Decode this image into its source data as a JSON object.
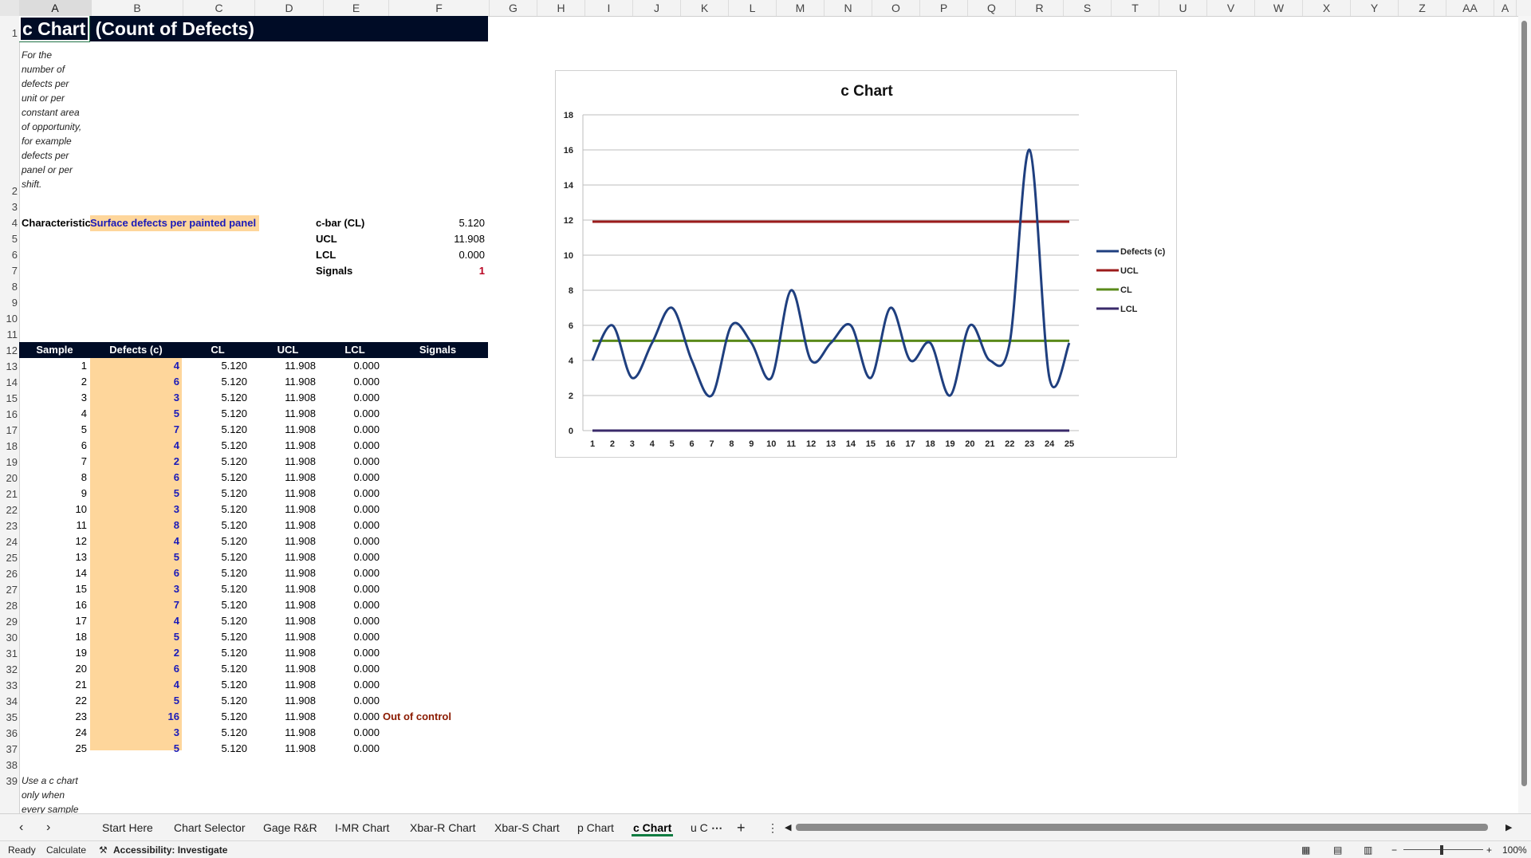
{
  "columns": [
    "A",
    "B",
    "C",
    "D",
    "E",
    "F",
    "G",
    "H",
    "I",
    "J",
    "K",
    "L",
    "M",
    "N",
    "O",
    "P",
    "Q",
    "R",
    "S",
    "T",
    "U",
    "V",
    "W",
    "X",
    "Y",
    "Z",
    "AA",
    "A"
  ],
  "title": {
    "cell_a1": "c Chart",
    "rest": "(Count of Defects)"
  },
  "description": [
    "For the",
    "number of",
    "defects per",
    "unit or per",
    "constant area",
    "of opportunity,",
    "for example",
    "defects per",
    "panel or per",
    "shift."
  ],
  "characteristic": {
    "label": "Characteristic",
    "value": "Surface defects per painted panel"
  },
  "summary": {
    "cbar_label": "c-bar (CL)",
    "cbar_value": "5.120",
    "ucl_label": "UCL",
    "ucl_value": "11.908",
    "lcl_label": "LCL",
    "lcl_value": "0.000",
    "signals_label": "Signals",
    "signals_value": "1"
  },
  "table": {
    "headers": [
      "Sample",
      "Defects (c)",
      "CL",
      "UCL",
      "LCL",
      "Signals"
    ],
    "rows": [
      [
        "1",
        "4",
        "5.120",
        "11.908",
        "0.000",
        ""
      ],
      [
        "2",
        "6",
        "5.120",
        "11.908",
        "0.000",
        ""
      ],
      [
        "3",
        "3",
        "5.120",
        "11.908",
        "0.000",
        ""
      ],
      [
        "4",
        "5",
        "5.120",
        "11.908",
        "0.000",
        ""
      ],
      [
        "5",
        "7",
        "5.120",
        "11.908",
        "0.000",
        ""
      ],
      [
        "6",
        "4",
        "5.120",
        "11.908",
        "0.000",
        ""
      ],
      [
        "7",
        "2",
        "5.120",
        "11.908",
        "0.000",
        ""
      ],
      [
        "8",
        "6",
        "5.120",
        "11.908",
        "0.000",
        ""
      ],
      [
        "9",
        "5",
        "5.120",
        "11.908",
        "0.000",
        ""
      ],
      [
        "10",
        "3",
        "5.120",
        "11.908",
        "0.000",
        ""
      ],
      [
        "11",
        "8",
        "5.120",
        "11.908",
        "0.000",
        ""
      ],
      [
        "12",
        "4",
        "5.120",
        "11.908",
        "0.000",
        ""
      ],
      [
        "13",
        "5",
        "5.120",
        "11.908",
        "0.000",
        ""
      ],
      [
        "14",
        "6",
        "5.120",
        "11.908",
        "0.000",
        ""
      ],
      [
        "15",
        "3",
        "5.120",
        "11.908",
        "0.000",
        ""
      ],
      [
        "16",
        "7",
        "5.120",
        "11.908",
        "0.000",
        ""
      ],
      [
        "17",
        "4",
        "5.120",
        "11.908",
        "0.000",
        ""
      ],
      [
        "18",
        "5",
        "5.120",
        "11.908",
        "0.000",
        ""
      ],
      [
        "19",
        "2",
        "5.120",
        "11.908",
        "0.000",
        ""
      ],
      [
        "20",
        "6",
        "5.120",
        "11.908",
        "0.000",
        ""
      ],
      [
        "21",
        "4",
        "5.120",
        "11.908",
        "0.000",
        ""
      ],
      [
        "22",
        "5",
        "5.120",
        "11.908",
        "0.000",
        ""
      ],
      [
        "23",
        "16",
        "5.120",
        "11.908",
        "0.000",
        "Out of control"
      ],
      [
        "24",
        "3",
        "5.120",
        "11.908",
        "0.000",
        ""
      ],
      [
        "25",
        "5",
        "5.120",
        "11.908",
        "0.000",
        ""
      ]
    ]
  },
  "footer_note": [
    "Use a c chart",
    "only when",
    "every sample"
  ],
  "chart_data": {
    "type": "line",
    "title": "c Chart",
    "x": [
      1,
      2,
      3,
      4,
      5,
      6,
      7,
      8,
      9,
      10,
      11,
      12,
      13,
      14,
      15,
      16,
      17,
      18,
      19,
      20,
      21,
      22,
      23,
      24,
      25
    ],
    "ylim": [
      0,
      18
    ],
    "yticks": [
      0,
      2,
      4,
      6,
      8,
      10,
      12,
      14,
      16,
      18
    ],
    "grid": true,
    "legend": "right",
    "series": [
      {
        "name": "Defects (c)",
        "color": "#1f3f7f",
        "values": [
          4,
          6,
          3,
          5,
          7,
          4,
          2,
          6,
          5,
          3,
          8,
          4,
          5,
          6,
          3,
          7,
          4,
          5,
          2,
          6,
          4,
          5,
          16,
          3,
          5
        ]
      },
      {
        "name": "UCL",
        "color": "#9b1b1b",
        "values": [
          11.908,
          11.908,
          11.908,
          11.908,
          11.908,
          11.908,
          11.908,
          11.908,
          11.908,
          11.908,
          11.908,
          11.908,
          11.908,
          11.908,
          11.908,
          11.908,
          11.908,
          11.908,
          11.908,
          11.908,
          11.908,
          11.908,
          11.908,
          11.908,
          11.908
        ]
      },
      {
        "name": "CL",
        "color": "#5a8a1a",
        "values": [
          5.12,
          5.12,
          5.12,
          5.12,
          5.12,
          5.12,
          5.12,
          5.12,
          5.12,
          5.12,
          5.12,
          5.12,
          5.12,
          5.12,
          5.12,
          5.12,
          5.12,
          5.12,
          5.12,
          5.12,
          5.12,
          5.12,
          5.12,
          5.12,
          5.12
        ]
      },
      {
        "name": "LCL",
        "color": "#3a2a6a",
        "values": [
          0,
          0,
          0,
          0,
          0,
          0,
          0,
          0,
          0,
          0,
          0,
          0,
          0,
          0,
          0,
          0,
          0,
          0,
          0,
          0,
          0,
          0,
          0,
          0,
          0
        ]
      }
    ]
  },
  "tabs": [
    "Start Here",
    "Chart Selector",
    "Gage R&R",
    "I-MR Chart",
    "Xbar-R Chart",
    "Xbar-S Chart",
    "p Chart",
    "c Chart",
    "u C"
  ],
  "active_tab": "c Chart",
  "status": {
    "ready": "Ready",
    "calculate": "Calculate",
    "accessibility": "Accessibility: Investigate",
    "zoom": "100%"
  }
}
